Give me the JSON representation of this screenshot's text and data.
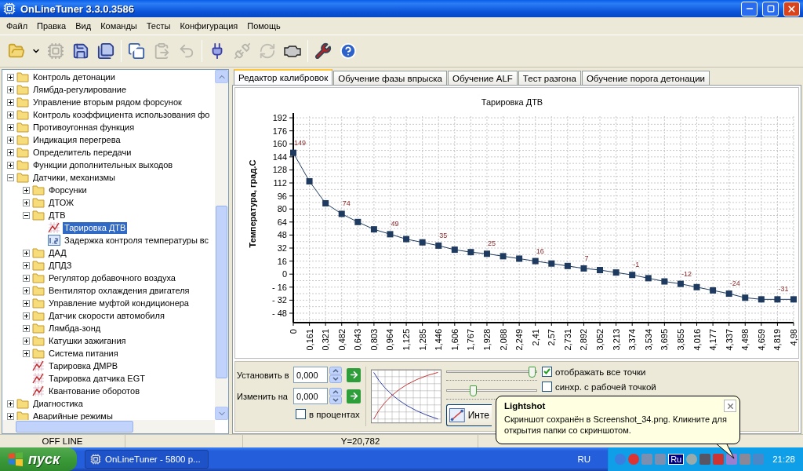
{
  "window": {
    "title": "OnLineTuner 3.3.0.3586"
  },
  "menu": [
    "Файл",
    "Правка",
    "Вид",
    "Команды",
    "Тесты",
    "Конфигурация",
    "Помощь"
  ],
  "toolbar": [
    {
      "kind": "open",
      "disabled": false
    },
    {
      "kind": "dropdown",
      "disabled": false
    },
    {
      "kind": "read",
      "disabled": true
    },
    {
      "kind": "save",
      "disabled": false
    },
    {
      "kind": "save_as",
      "disabled": false
    },
    {
      "kind": "separator"
    },
    {
      "kind": "copy",
      "disabled": false
    },
    {
      "kind": "paste",
      "disabled": true
    },
    {
      "kind": "undo",
      "disabled": true
    },
    {
      "kind": "separator"
    },
    {
      "kind": "connect",
      "disabled": false
    },
    {
      "kind": "disconnect",
      "disabled": true
    },
    {
      "kind": "refresh",
      "disabled": true
    },
    {
      "kind": "engine",
      "disabled": false
    },
    {
      "kind": "separator"
    },
    {
      "kind": "tools",
      "disabled": false
    },
    {
      "kind": "help",
      "disabled": false
    }
  ],
  "tree": [
    {
      "label": "Контроль детонации",
      "kind": "folder",
      "expanded": false,
      "selected": false
    },
    {
      "label": "Лямбда-регулирование",
      "kind": "folder",
      "expanded": false,
      "selected": false
    },
    {
      "label": "Управление вторым рядом форсунок",
      "kind": "folder",
      "expanded": false,
      "selected": false
    },
    {
      "label": "Контроль коэффициента использования фо",
      "kind": "folder",
      "expanded": false,
      "selected": false
    },
    {
      "label": "Противоугонная функция",
      "kind": "folder",
      "expanded": false,
      "selected": false
    },
    {
      "label": "Индикация перегрева",
      "kind": "folder",
      "expanded": false,
      "selected": false
    },
    {
      "label": "Определитель передачи",
      "kind": "folder",
      "expanded": false,
      "selected": false
    },
    {
      "label": "Функции дополнительных выходов",
      "kind": "folder",
      "expanded": false,
      "selected": false
    },
    {
      "label": "Датчики, механизмы",
      "kind": "folder",
      "expanded": true,
      "selected": false,
      "children": [
        {
          "label": "Форсунки",
          "kind": "folder",
          "expanded": false,
          "selected": false
        },
        {
          "label": "ДТОЖ",
          "kind": "folder",
          "expanded": false,
          "selected": false
        },
        {
          "label": "ДТВ",
          "kind": "folder",
          "expanded": true,
          "selected": false,
          "children": [
            {
              "label": "Тарировка ДТВ",
              "kind": "table",
              "selected": true
            },
            {
              "label": "Задержка контроля температуры вс",
              "kind": "number",
              "selected": false
            }
          ]
        },
        {
          "label": "ДАД",
          "kind": "folder",
          "expanded": false,
          "selected": false
        },
        {
          "label": "ДПДЗ",
          "kind": "folder",
          "expanded": false,
          "selected": false
        },
        {
          "label": "Регулятор добавочного воздуха",
          "kind": "folder",
          "expanded": false,
          "selected": false
        },
        {
          "label": "Вентилятор охлаждения двигателя",
          "kind": "folder",
          "expanded": false,
          "selected": false
        },
        {
          "label": "Управление муфтой кондиционера",
          "kind": "folder",
          "expanded": false,
          "selected": false
        },
        {
          "label": "Датчик скорости автомобиля",
          "kind": "folder",
          "expanded": false,
          "selected": false
        },
        {
          "label": "Лямбда-зонд",
          "kind": "folder",
          "expanded": false,
          "selected": false
        },
        {
          "label": "Катушки зажигания",
          "kind": "folder",
          "expanded": false,
          "selected": false
        },
        {
          "label": "Система питания",
          "kind": "folder",
          "expanded": false,
          "selected": false
        },
        {
          "label": "Тарировка ДМРВ",
          "kind": "table",
          "selected": false
        },
        {
          "label": "Тарировка датчика EGT",
          "kind": "table",
          "selected": false
        },
        {
          "label": "Квантование оборотов",
          "kind": "table",
          "selected": false
        }
      ]
    },
    {
      "label": "Диагностика",
      "kind": "folder",
      "expanded": false,
      "selected": false
    },
    {
      "label": "Аварийные режимы",
      "kind": "folder",
      "expanded": false,
      "selected": false
    }
  ],
  "tabs": [
    {
      "label": "Редактор калибровок",
      "selected": true
    },
    {
      "label": "Обучение фазы впрыска",
      "selected": false
    },
    {
      "label": "Обучение ALF",
      "selected": false
    },
    {
      "label": "Тест разгона",
      "selected": false
    },
    {
      "label": "Обучение порога детонации",
      "selected": false
    }
  ],
  "chart": {
    "chart_data": {
      "type": "line",
      "title": "Тарировка ДТВ",
      "ylabel": "Температура, град.С",
      "categories": [
        "0",
        "0,161",
        "0,321",
        "0,482",
        "0,643",
        "0,803",
        "0,964",
        "1,125",
        "1,285",
        "1,446",
        "1,606",
        "1,767",
        "1,928",
        "2,088",
        "2,249",
        "2,41",
        "2,57",
        "2,731",
        "2,892",
        "3,052",
        "3,213",
        "3,374",
        "3,534",
        "3,695",
        "3,855",
        "4,016",
        "4,177",
        "4,337",
        "4,498",
        "4,659",
        "4,819",
        "4,98"
      ],
      "grid": true,
      "series": [
        {
          "color": "#1f3a5f",
          "marker": "square",
          "values": [
            149,
            114,
            87,
            74,
            64,
            55,
            49,
            43,
            39,
            35,
            30,
            27,
            25,
            22,
            19,
            16,
            13,
            10,
            7,
            5,
            2,
            -1,
            -5,
            -9,
            -12,
            -16,
            -20,
            -24,
            -29,
            -31,
            -31,
            -31
          ]
        }
      ],
      "value_labels": [
        "149",
        null,
        null,
        "74",
        null,
        null,
        "49",
        null,
        null,
        "35",
        null,
        null,
        "25",
        null,
        null,
        "16",
        null,
        null,
        "7",
        null,
        null,
        "-1",
        null,
        null,
        "-12",
        null,
        null,
        "-24",
        null,
        null,
        "-31",
        null
      ],
      "ylim": [
        -59.6,
        194
      ],
      "yticks": [
        192,
        176,
        160,
        144,
        128,
        112,
        96,
        80,
        64,
        48,
        32,
        16,
        0,
        {
          "value": -16,
          "label": "- 16"
        },
        {
          "value": -32,
          "label": "- 32"
        },
        {
          "value": -48,
          "label": "- 48"
        }
      ]
    }
  },
  "controls": {
    "set_label": "Установить в",
    "set_value": "0,000",
    "change_label": "Изменить на",
    "change_value": "0,000",
    "percent": {
      "label": "в процентах",
      "checked": false
    },
    "sliders": [
      {
        "level": 0.95
      },
      {
        "level": 0.3
      }
    ],
    "button": "Инте",
    "options": [
      {
        "label": "отображать все точки",
        "checked": true
      },
      {
        "label": "синхр. с рабочей точкой",
        "checked": false
      }
    ]
  },
  "status_bar": [
    "OFF LINE",
    "Y=20,782"
  ],
  "taskbar": {
    "start": "пуск",
    "task": "OnLineTuner - 5800 р...",
    "language": "RU",
    "tray_text": "Ru",
    "clock": "21:28"
  },
  "balloon": {
    "title": "Lightshot",
    "text": "Скриншот сохранён в Screenshot_34.png. Кликните для открытия папки со скриншотом."
  }
}
